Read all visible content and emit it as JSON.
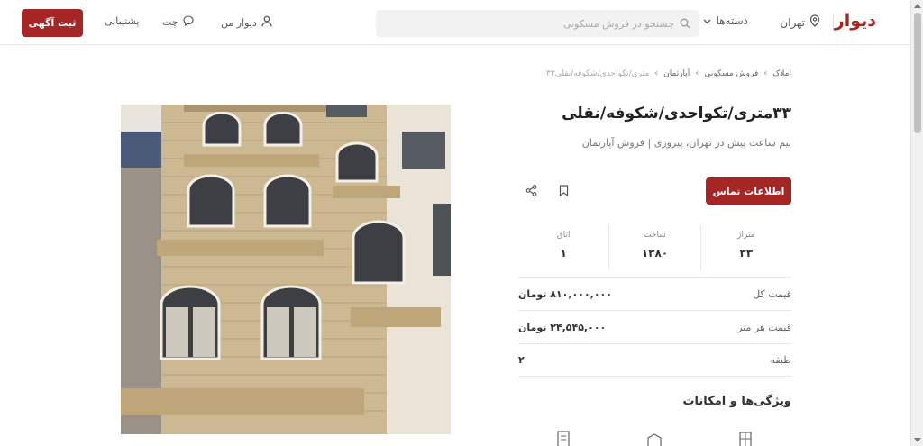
{
  "header": {
    "logo": "دیوار",
    "city": "تهران",
    "categories": "دسته‌ها",
    "search_placeholder": "جستجو در فروش مسکونی",
    "my_divar": "دیوار من",
    "chat": "چت",
    "support": "پشتیبانی",
    "post_button": "ثبت آگهی"
  },
  "breadcrumb": [
    "املاک",
    "فروش مسکونی",
    "آپارتمان",
    "۳۳متری/تکواحدی/شکوفه/نقلی"
  ],
  "listing": {
    "title": "۳۳متری/تکواحدی/شکوفه/نقلی",
    "subtitle": "نیم ساعت پیش در تهران، پیروزی | فروش آپارتمان",
    "contact_button": "اطلاعات تماس",
    "stats": [
      {
        "label": "متراژ",
        "value": "۳۳"
      },
      {
        "label": "ساخت",
        "value": "۱۳۸۰"
      },
      {
        "label": "اتاق",
        "value": "۱"
      }
    ],
    "rows": [
      {
        "key": "قیمت کل",
        "value": "۸۱۰,۰۰۰,۰۰۰ تومان"
      },
      {
        "key": "قیمت هر متر",
        "value": "۲۴,۵۴۵,۰۰۰ تومان"
      },
      {
        "key": "طبقه",
        "value": "۲"
      }
    ],
    "features_title": "ویژگی‌ها و امکانات"
  },
  "colors": {
    "brand": "#a62626"
  },
  "icons": [
    "location-pin-icon",
    "chevron-down-icon",
    "search-icon",
    "user-icon",
    "chat-bubble-icon",
    "bookmark-icon",
    "share-icon"
  ]
}
